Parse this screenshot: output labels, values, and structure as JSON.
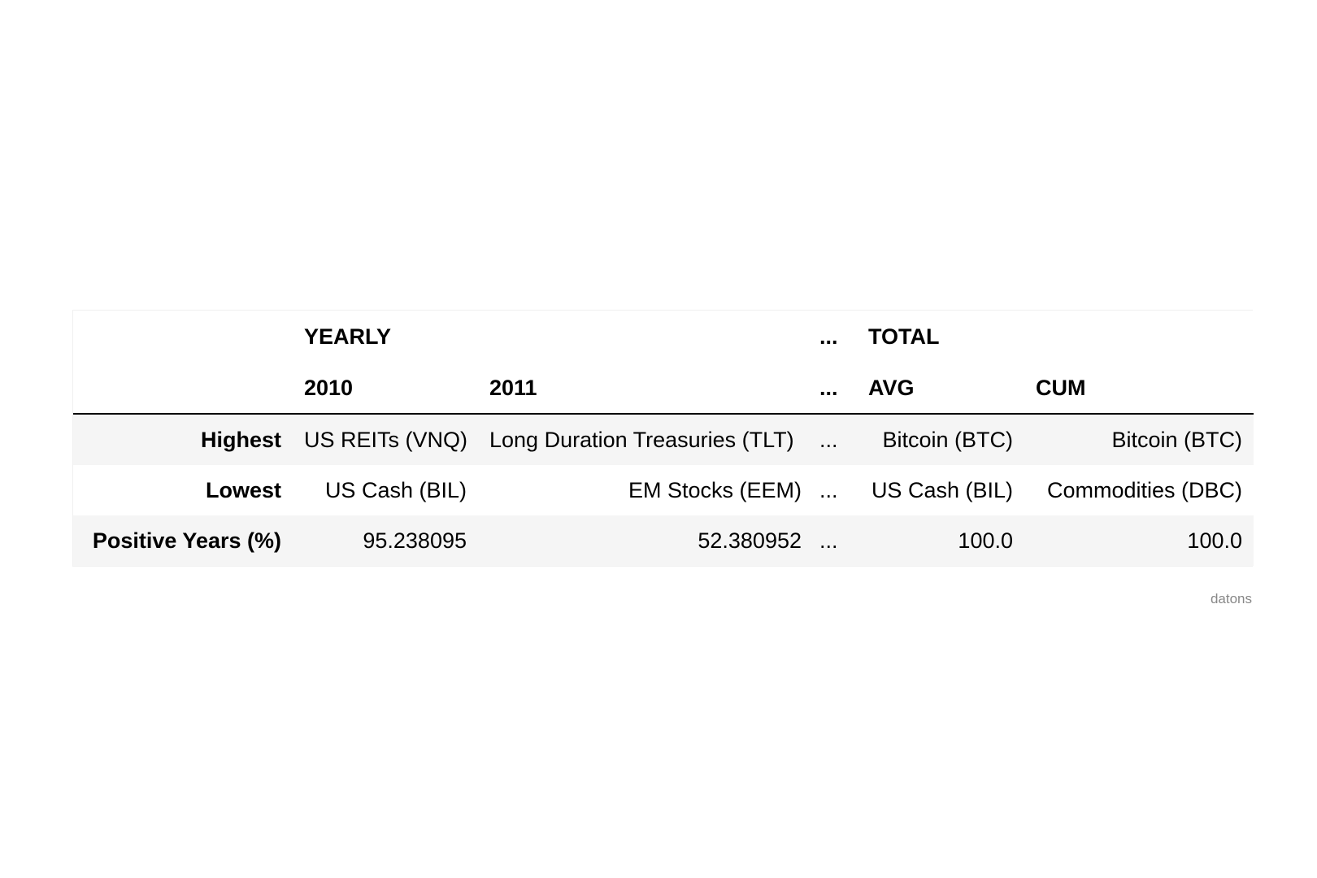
{
  "table": {
    "header_level1": [
      "",
      "YEARLY",
      "",
      "...",
      "TOTAL",
      ""
    ],
    "header_level2": [
      "",
      "2010",
      "2011",
      "...",
      "AVG",
      "CUM"
    ],
    "rows": [
      {
        "label": "Highest",
        "cells": [
          "US REITs (VNQ)",
          "Long Duration Treasuries (TLT)",
          "...",
          "Bitcoin (BTC)",
          "Bitcoin (BTC)"
        ]
      },
      {
        "label": "Lowest",
        "cells": [
          "US Cash (BIL)",
          "EM Stocks (EEM)",
          "...",
          "US Cash (BIL)",
          "Commodities (DBC)"
        ]
      },
      {
        "label": "Positive Years (%)",
        "cells": [
          "95.238095",
          "52.380952",
          "...",
          "100.0",
          "100.0"
        ]
      }
    ]
  },
  "credit": "datons"
}
